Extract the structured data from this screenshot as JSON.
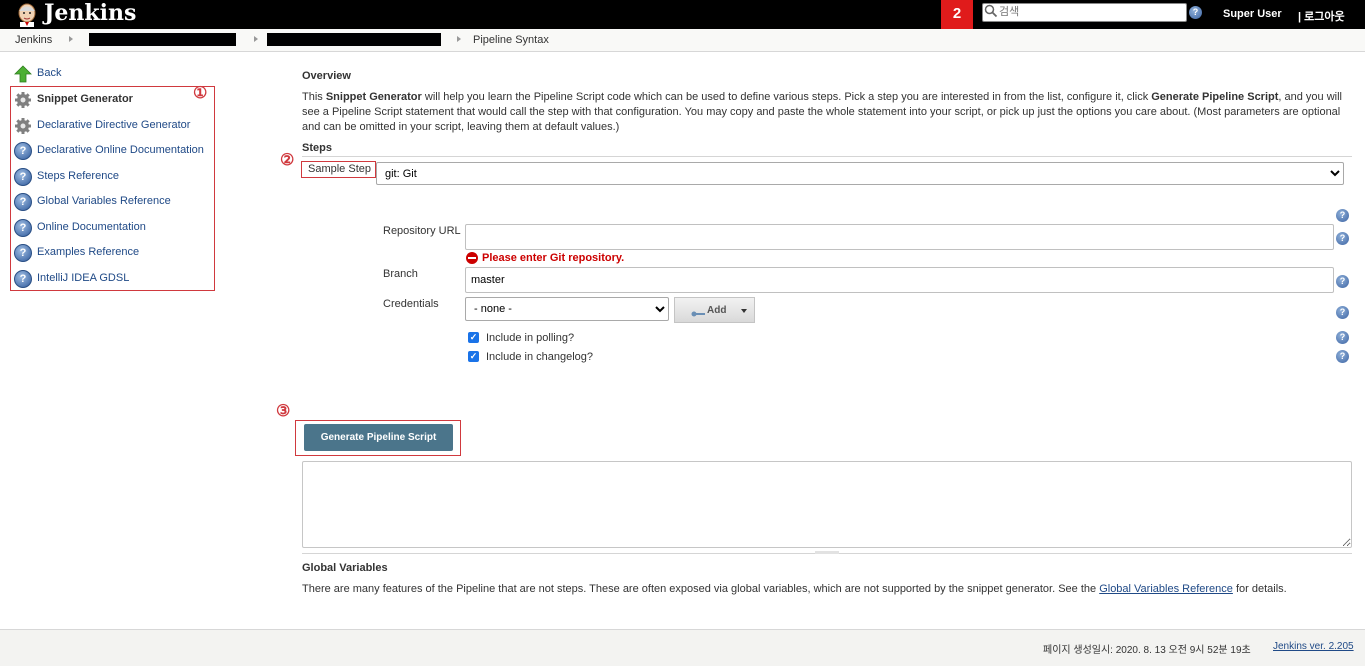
{
  "header": {
    "logo_text": "Jenkins",
    "notification_count": "2",
    "search_placeholder": "검색",
    "help_glyph": "?",
    "user": "Super User",
    "logout": "| 로그아웃"
  },
  "breadcrumb": {
    "items": [
      "Jenkins",
      "Pipeline Syntax"
    ]
  },
  "side_panel": {
    "items": [
      {
        "label": "Back",
        "icon": "up-arrow-icon"
      },
      {
        "label": "Snippet Generator",
        "icon": "gear-icon",
        "active": true
      },
      {
        "label": "Declarative Directive Generator",
        "icon": "gear-icon"
      },
      {
        "label": "Declarative Online Documentation",
        "icon": "help-icon"
      },
      {
        "label": "Steps Reference",
        "icon": "help-icon"
      },
      {
        "label": "Global Variables Reference",
        "icon": "help-icon"
      },
      {
        "label": "Online Documentation",
        "icon": "help-icon"
      },
      {
        "label": "Examples Reference",
        "icon": "help-icon"
      },
      {
        "label": "IntelliJ IDEA GDSL",
        "icon": "help-icon"
      }
    ]
  },
  "markers": [
    "①",
    "②",
    "③"
  ],
  "overview": {
    "title": "Overview",
    "p1": "This ",
    "b1": "Snippet Generator",
    "p2": " will help you learn the Pipeline Script code which can be used to define various steps. Pick a step you are interested in from the list, configure it, click ",
    "b2": "Generate Pipeline Script",
    "p3": ", and you will see a Pipeline Script statement that would call the step with that configuration. You may copy and paste the whole statement into your script, or pick up just the options you care about. (Most parameters are optional and can be omitted in your script, leaving them at default values.)"
  },
  "steps": {
    "title": "Steps",
    "sample_step_label": "Sample Step",
    "sample_step_value": "git: Git",
    "repo_url_label": "Repository URL",
    "repo_url_value": "",
    "error": "Please enter Git repository.",
    "branch_label": "Branch",
    "branch_value": "master",
    "credentials_label": "Credentials",
    "credentials_value": "- none -",
    "add_label": "Add",
    "include_polling": "Include in polling?",
    "include_changelog": "Include in changelog?",
    "checkbox_mark": "✓"
  },
  "generate_button": "Generate Pipeline Script",
  "output_script": "",
  "global_variables": {
    "title": "Global Variables",
    "text_before": "There are many features of the Pipeline that are not steps. These are often exposed via global variables, which are not supported by the snippet generator. See the ",
    "link": "Global Variables Reference",
    "text_after": " for details."
  },
  "footer": {
    "generated": "페이지 생성일시: 2020. 8. 13 오전 9시 52분 19초",
    "version_link": "Jenkins ver. 2.205"
  },
  "colors": {
    "header_bg": "#000000",
    "notification_bg": "#e01b1b",
    "button_bg": "#4b758b",
    "annotation_red": "#d0393e",
    "error_red": "#cc0000",
    "link_blue": "#204a87"
  }
}
